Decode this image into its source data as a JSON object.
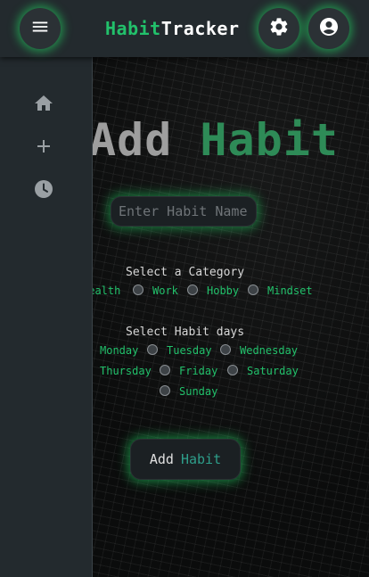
{
  "header": {
    "brand_part1": "Habit",
    "brand_part2": "Tracker",
    "icons": [
      "menu-icon",
      "settings-icon",
      "account-icon"
    ]
  },
  "sidebar": {
    "items": [
      {
        "icon": "home-icon"
      },
      {
        "icon": "add-icon"
      },
      {
        "icon": "history-icon"
      }
    ]
  },
  "main": {
    "title_part1": "Add",
    "title_part2": "Habit",
    "name_placeholder": "Enter Habit Name",
    "category_label": "Select a Category",
    "categories": [
      "Health",
      "Work",
      "Hobby",
      "Mindset"
    ],
    "days_label": "Select Habit days",
    "days": [
      "Monday",
      "Tuesday",
      "Wednesday",
      "Thursday",
      "Friday",
      "Saturday",
      "Sunday"
    ],
    "submit_part1": "Add",
    "submit_part2": "Habit"
  },
  "colors": {
    "accent": "#22c16b",
    "panel": "#232a2e",
    "title_gray": "#9e9e9e",
    "title_green": "#2e8b57"
  }
}
